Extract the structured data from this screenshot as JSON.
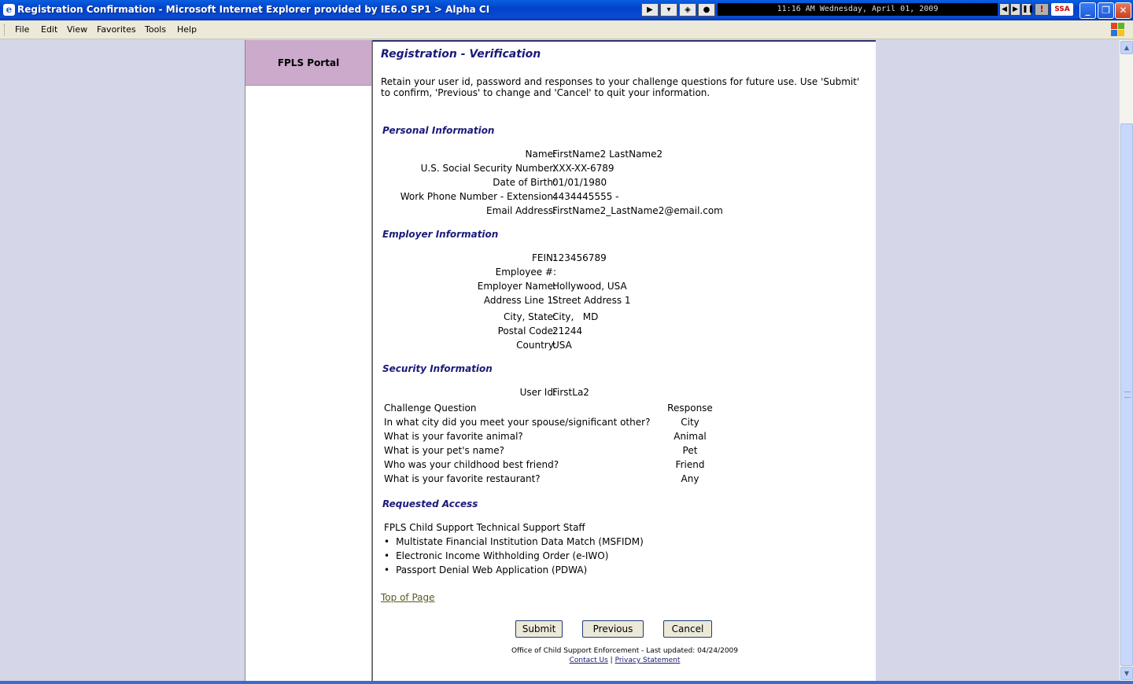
{
  "window": {
    "title": "Registration Confirmation - Microsoft Internet Explorer provided by IE6.0 SP1  > Alpha CI",
    "clock": "11:16 AM Wednesday, April 01, 2009",
    "ssa_badge": "SSA",
    "alert": "!",
    "minimize": "_",
    "maximize": "❐",
    "close": "✕"
  },
  "menubar": {
    "items": [
      "File",
      "Edit",
      "View",
      "Favorites",
      "Tools",
      "Help"
    ]
  },
  "sidebar": {
    "portal_label": "FPLS Portal"
  },
  "page": {
    "title": "Registration - Verification",
    "intro": "Retain your user id, password and responses to your challenge questions for future use. Use 'Submit' to confirm, 'Previous' to change and 'Cancel' to quit your information."
  },
  "personal": {
    "heading": "Personal Information",
    "rows": [
      {
        "label": "Name:",
        "value": "FirstName2 LastName2"
      },
      {
        "label": "U.S. Social Security Number:",
        "value": "XXX-XX-6789"
      },
      {
        "label": "Date of Birth:",
        "value": "01/01/1980"
      },
      {
        "label": "Work Phone Number - Extension:",
        "value": "4434445555 -"
      },
      {
        "label": "Email Address:",
        "value": "FirstName2_LastName2@email.com"
      }
    ]
  },
  "employer": {
    "heading": "Employer Information",
    "rows": [
      {
        "label": "FEIN:",
        "value": "123456789"
      },
      {
        "label": "Employee #:",
        "value": ""
      },
      {
        "label": "Employer Name:",
        "value": "Hollywood, USA"
      },
      {
        "label": "Address Line 1:",
        "value": "Street Address 1"
      },
      {
        "label": "City, State:",
        "value": "City,   MD"
      },
      {
        "label": "Postal Code:",
        "value": "21244"
      },
      {
        "label": "Country:",
        "value": "USA"
      }
    ]
  },
  "security": {
    "heading": "Security Information",
    "user_id_label": "User Id:",
    "user_id": "FirstLa2",
    "col_question": "Challenge Question",
    "col_response": "Response",
    "questions": [
      {
        "q": "In what city did you meet your spouse/significant other?",
        "a": "City"
      },
      {
        "q": "What is your favorite animal?",
        "a": "Animal"
      },
      {
        "q": "What is your pet's name?",
        "a": "Pet"
      },
      {
        "q": "Who was your childhood best friend?",
        "a": "Friend"
      },
      {
        "q": "What is your favorite restaurant?",
        "a": "Any"
      }
    ]
  },
  "access": {
    "heading": "Requested Access",
    "role": "FPLS Child Support Technical Support Staff",
    "items": [
      "Multistate Financial Institution Data Match (MSFIDM)",
      "Electronic Income Withholding Order (e-IWO)",
      "Passport Denial Web Application (PDWA)"
    ]
  },
  "links": {
    "top_of_page": "Top of Page"
  },
  "buttons": {
    "submit": "Submit",
    "previous": "Previous",
    "cancel": "Cancel"
  },
  "footer": {
    "line": "Office of Child Support Enforcement - Last updated: 04/24/2009",
    "contact": "Contact Us",
    "sep": "|",
    "privacy": "Privacy Statement"
  }
}
